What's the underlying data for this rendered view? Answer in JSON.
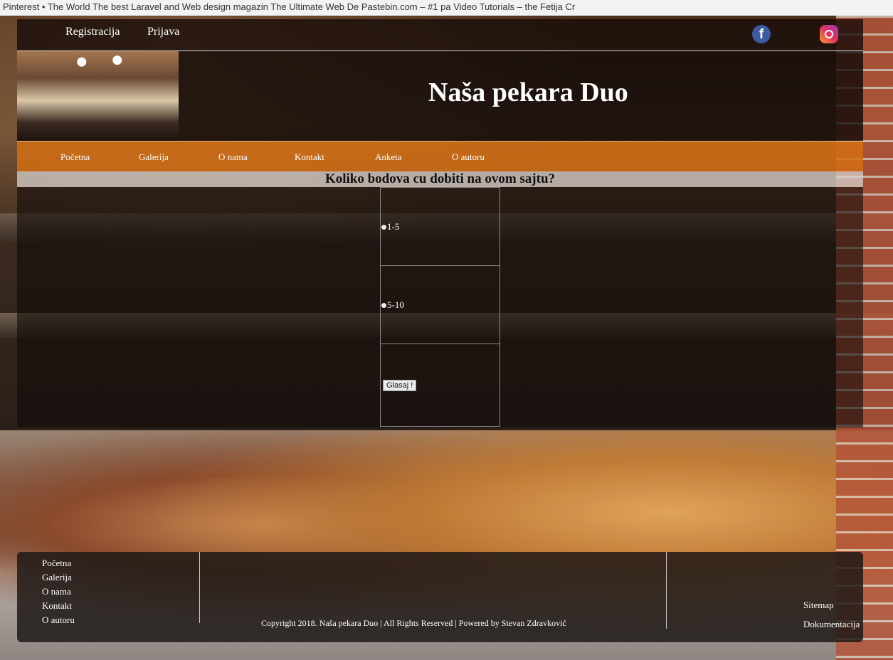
{
  "browser": {
    "bookmarks": "Pinterest • The World   The best Laravel and   Web design magazin   The Ultimate Web De   Pastebin.com – #1 pa   Video Tutorials – the   Fetija   Cr"
  },
  "topbar": {
    "register": "Registracija",
    "login": "Prijava",
    "facebook_icon": "f"
  },
  "header": {
    "title": "Naša pekara Duo"
  },
  "nav": {
    "items": [
      {
        "label": "Početna"
      },
      {
        "label": "Galerija"
      },
      {
        "label": "O nama"
      },
      {
        "label": "Kontakt"
      },
      {
        "label": "Anketa"
      },
      {
        "label": "O autoru"
      }
    ]
  },
  "poll": {
    "question": "Koliko bodova cu dobiti na ovom sajtu?",
    "options": [
      {
        "label": "1-5"
      },
      {
        "label": "5-10"
      }
    ],
    "submit": "Glasaj !"
  },
  "footer": {
    "links": [
      {
        "label": "Početna"
      },
      {
        "label": "Galerija"
      },
      {
        "label": "O nama"
      },
      {
        "label": "Kontakt"
      },
      {
        "label": "O autoru"
      }
    ],
    "copyright": "Copyright 2018. Naša pekara Duo | All Rights Reserved | Powered by Stevan Zdravković",
    "sitemap": "Sitemap",
    "docs": "Dokumentacija"
  }
}
